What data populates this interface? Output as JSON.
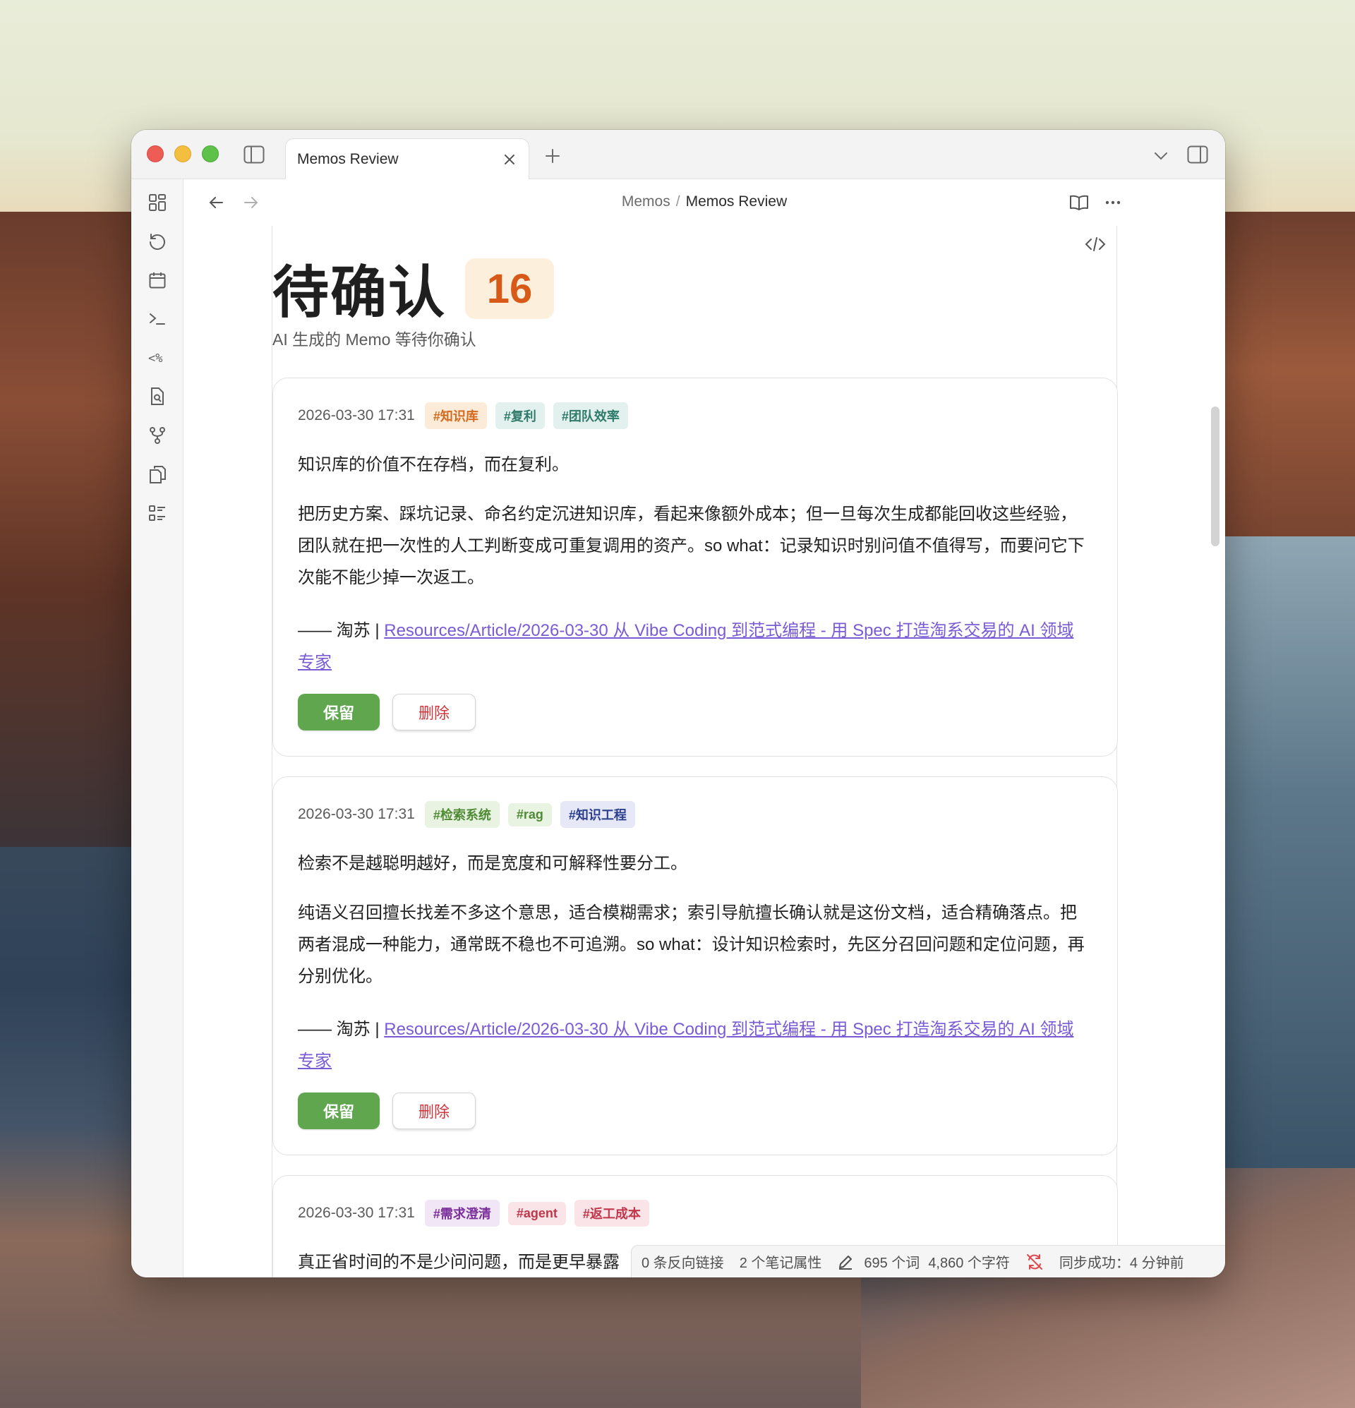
{
  "window": {
    "tab_title": "Memos Review"
  },
  "breadcrumb": {
    "parent": "Memos",
    "separator": "/",
    "current": "Memos Review"
  },
  "page": {
    "title": "待确认",
    "count": "16",
    "subtitle": "AI 生成的 Memo 等待你确认"
  },
  "cards": [
    {
      "time": "2026-03-30 17:31",
      "tags": [
        {
          "label": "#知识库",
          "bg": "#fcebd8",
          "fg": "#d46a1e"
        },
        {
          "label": "#复利",
          "bg": "#e3f1ee",
          "fg": "#2f7a6a"
        },
        {
          "label": "#团队效率",
          "bg": "#e3f1ee",
          "fg": "#2f7a6a"
        }
      ],
      "headline": "知识库的价值不在存档，而在复利。",
      "body": "把历史方案、踩坑记录、命名约定沉进知识库，看起来像额外成本；但一旦每次生成都能回收这些经验，团队就在把一次性的人工判断变成可重复调用的资产。so what：记录知识时别问值不值得写，而要问它下次能不能少掉一次返工。",
      "source_prefix": "—— 淘苏 | ",
      "source_link": "Resources/Article/2026-03-30 从 Vibe Coding 到范式编程 - 用 Spec 打造淘系交易的 AI 领域专家",
      "keep_label": "保留",
      "delete_label": "删除"
    },
    {
      "time": "2026-03-30 17:31",
      "tags": [
        {
          "label": "#检索系统",
          "bg": "#e9f3e1",
          "fg": "#4f8a34"
        },
        {
          "label": "#rag",
          "bg": "#e9f3e1",
          "fg": "#4f8a34"
        },
        {
          "label": "#知识工程",
          "bg": "#e6e8f7",
          "fg": "#2c3f8f"
        }
      ],
      "headline": "检索不是越聪明越好，而是宽度和可解释性要分工。",
      "body": "纯语义召回擅长找差不多这个意思，适合模糊需求；索引导航擅长确认就是这份文档，适合精确落点。把两者混成一种能力，通常既不稳也不可追溯。so what：设计知识检索时，先区分召回问题和定位问题，再分别优化。",
      "source_prefix": "—— 淘苏 | ",
      "source_link": "Resources/Article/2026-03-30 从 Vibe Coding 到范式编程 - 用 Spec 打造淘系交易的 AI 领域专家",
      "keep_label": "保留",
      "delete_label": "删除"
    },
    {
      "time": "2026-03-30 17:31",
      "tags": [
        {
          "label": "#需求澄清",
          "bg": "#f1e6f5",
          "fg": "#7a2f9a"
        },
        {
          "label": "#agent",
          "bg": "#fbe4e8",
          "fg": "#c0364a"
        },
        {
          "label": "#返工成本",
          "bg": "#fbe4e8",
          "fg": "#c0364a"
        }
      ],
      "headline": "真正省时间的不是少问问题，而是更早暴露"
    }
  ],
  "status": {
    "backlinks": "0 条反向链接",
    "properties": "2 个笔记属性",
    "words": "695 个词",
    "chars": "4,860 个字符",
    "sync": "同步成功：4 分钟前"
  }
}
